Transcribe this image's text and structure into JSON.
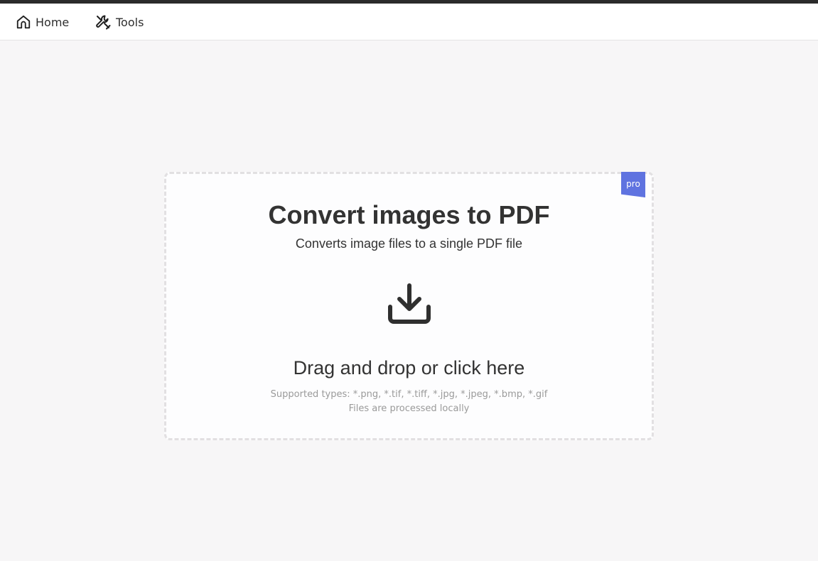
{
  "nav": {
    "home": {
      "label": "Home",
      "icon": "home-icon"
    },
    "tools": {
      "label": "Tools",
      "icon": "tools-icon"
    }
  },
  "dropzone": {
    "badge": "pro",
    "title": "Convert images to PDF",
    "subtitle": "Converts image files to a single PDF file",
    "icon": "download-icon",
    "drop_text": "Drag and drop or click here",
    "supported_types": "Supported types: *.png, *.tif, *.tiff, *.jpg, *.jpeg, *.bmp, *.gif",
    "processing_note": "Files are processed locally"
  },
  "colors": {
    "badge": "#5f73e0",
    "background": "#f7f6f7",
    "text": "#333333",
    "muted_text": "#9a9a9a",
    "dashed_border": "#e2e0e2"
  }
}
